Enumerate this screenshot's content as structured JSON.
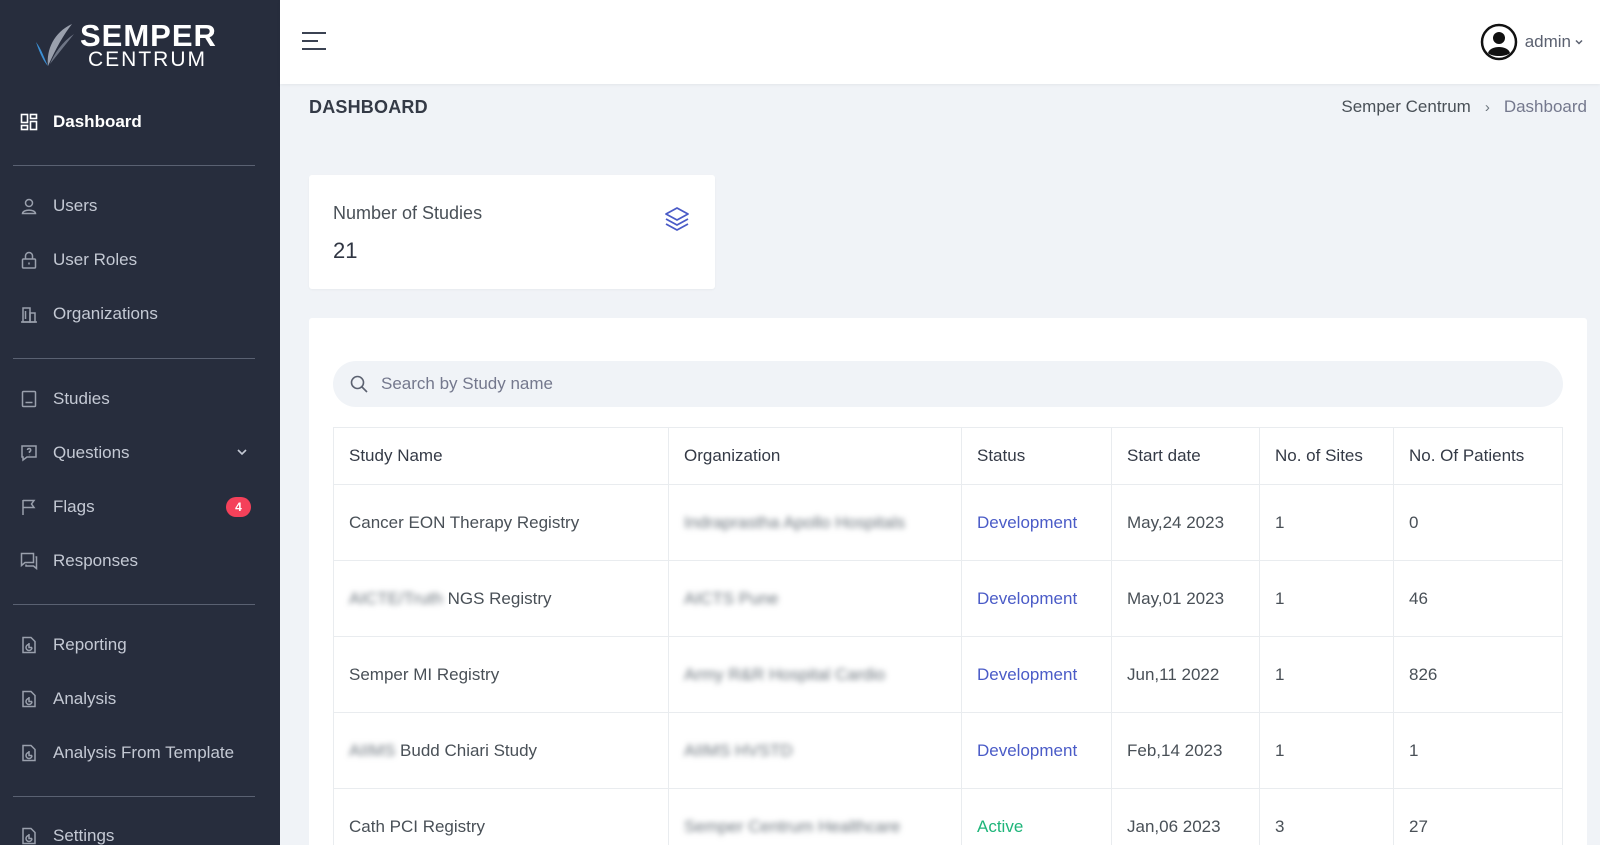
{
  "brand": {
    "line1": "SEMPER",
    "line2": "CENTRUM"
  },
  "sidebar": {
    "items": [
      {
        "label": "Dashboard",
        "icon": "dashboard-icon",
        "active": true
      },
      {
        "label": "Users",
        "icon": "user-icon"
      },
      {
        "label": "User Roles",
        "icon": "lock-icon"
      },
      {
        "label": "Organizations",
        "icon": "building-icon"
      },
      {
        "label": "Studies",
        "icon": "book-icon"
      },
      {
        "label": "Questions",
        "icon": "question-icon"
      },
      {
        "label": "Flags",
        "icon": "flag-icon",
        "badge": "4"
      },
      {
        "label": "Responses",
        "icon": "chat-icon"
      },
      {
        "label": "Reporting",
        "icon": "report-icon"
      },
      {
        "label": "Analysis",
        "icon": "report-icon"
      },
      {
        "label": "Analysis From Template",
        "icon": "report-icon"
      },
      {
        "label": "Settings",
        "icon": "report-icon"
      }
    ]
  },
  "header": {
    "username": "admin"
  },
  "page": {
    "title": "DASHBOARD",
    "breadcrumb": [
      "Semper Centrum",
      "Dashboard"
    ]
  },
  "stat": {
    "label": "Number of Studies",
    "value": "21"
  },
  "search": {
    "placeholder": "Search by Study name"
  },
  "table": {
    "columns": [
      "Study Name",
      "Organization",
      "Status",
      "Start date",
      "No. of Sites",
      "No. Of Patients"
    ],
    "rows": [
      {
        "name_pre": "",
        "name": "Cancer EON Therapy Registry",
        "org": "Indraprastha Apollo Hospitals",
        "status": "Development",
        "start": "May,24 2023",
        "sites": "1",
        "patients": "0"
      },
      {
        "name_pre": "AICTE/Truth",
        "name": "NGS Registry",
        "org": "AICTS Pune",
        "status": "Development",
        "start": "May,01 2023",
        "sites": "1",
        "patients": "46"
      },
      {
        "name_pre": "",
        "name": "Semper MI Registry",
        "org": "Army R&R Hospital Cardio",
        "status": "Development",
        "start": "Jun,11 2022",
        "sites": "1",
        "patients": "826"
      },
      {
        "name_pre": "AIIMS",
        "name": "Budd Chiari Study",
        "org": "AIIMS HVSTD",
        "status": "Development",
        "start": "Feb,14 2023",
        "sites": "1",
        "patients": "1"
      },
      {
        "name_pre": "",
        "name": "Cath PCI Registry",
        "org": "Semper Centrum Healthcare",
        "status": "Active",
        "start": "Jan,06 2023",
        "sites": "3",
        "patients": "27"
      }
    ]
  },
  "colors": {
    "sidebar_bg": "#272d3d",
    "accent": "#4a5bc7",
    "active_status": "#1fb57a",
    "badge": "#f4415a"
  }
}
